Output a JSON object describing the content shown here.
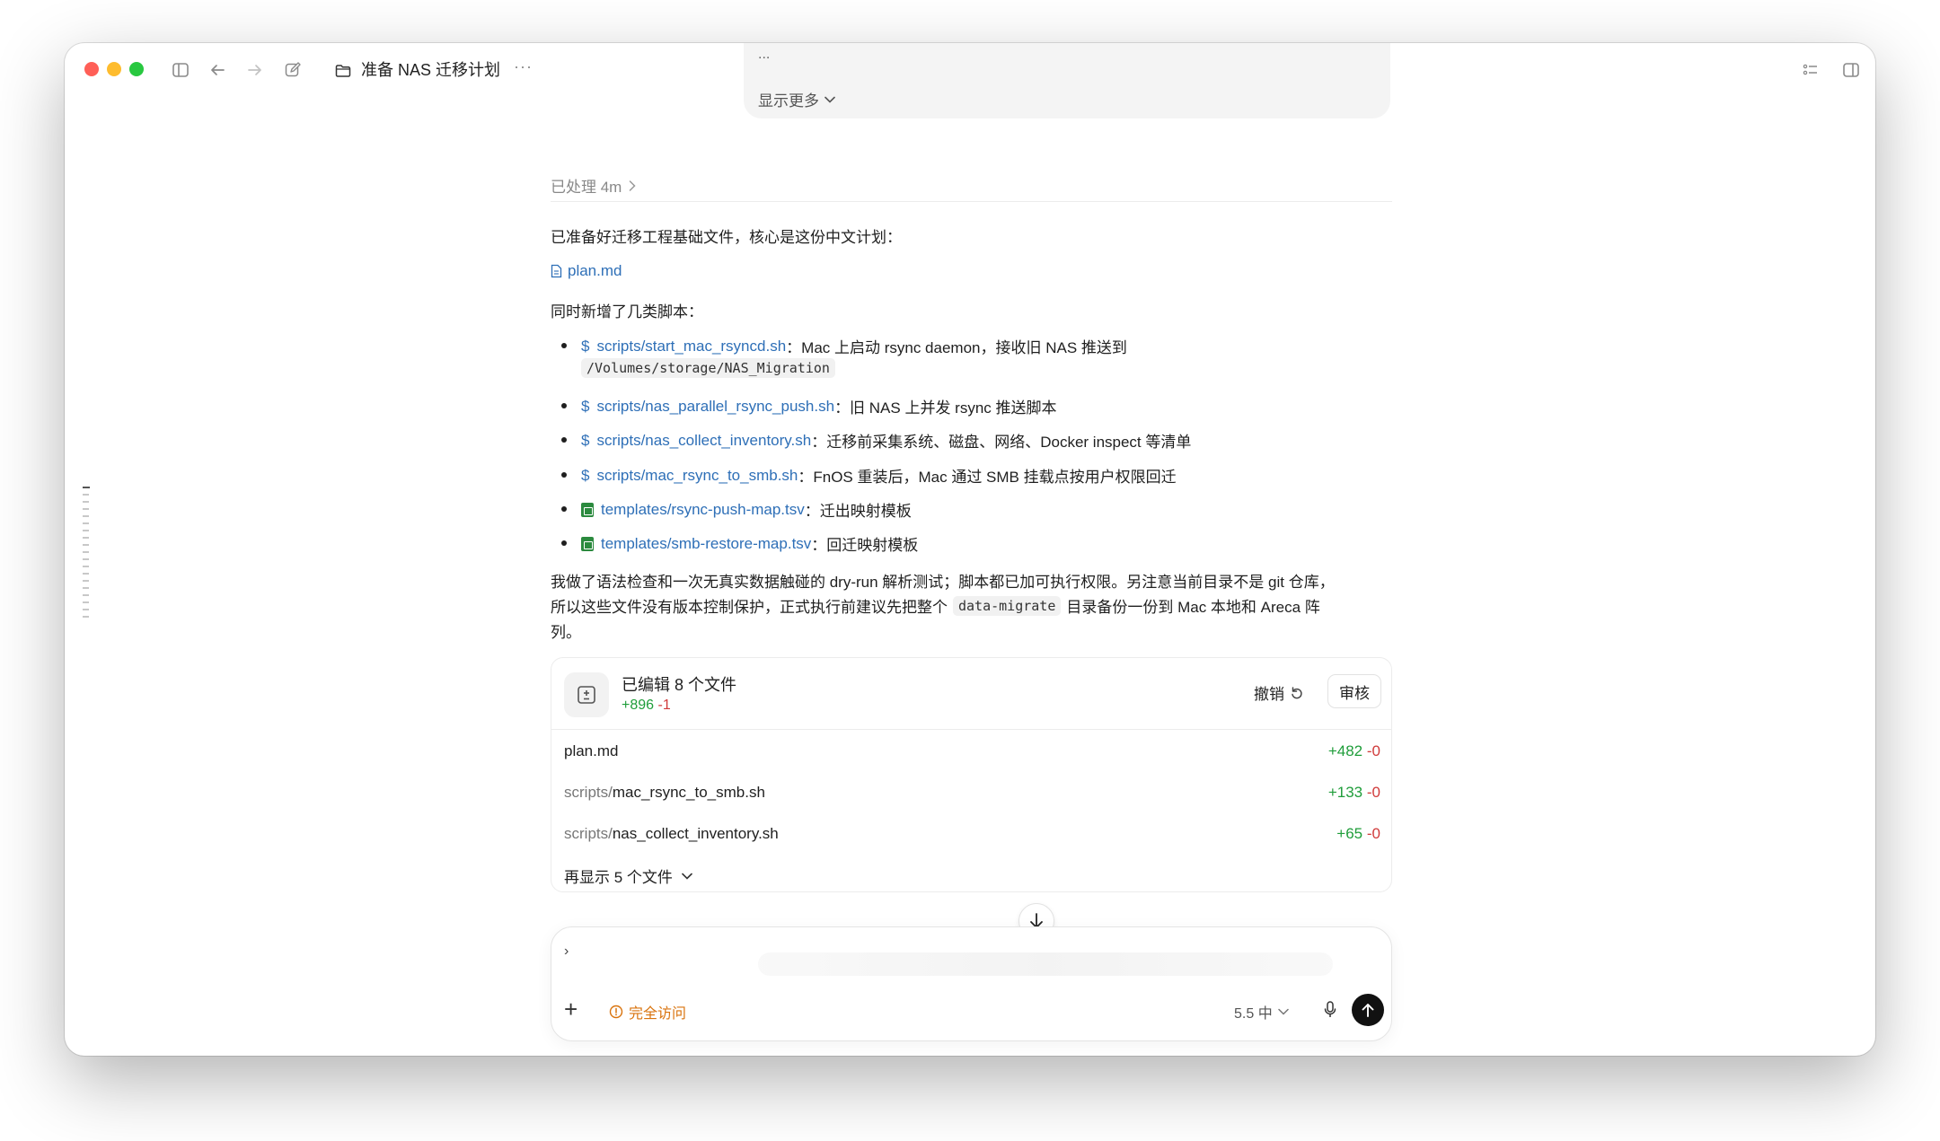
{
  "window": {
    "title": "准备 NAS 迁移计划",
    "more": "···"
  },
  "previous_message": {
    "ellipsis": "...",
    "show_more": "显示更多"
  },
  "processed": "已处理 4m",
  "intro": "已准备好迁移工程基础文件，核心是这份中文计划：",
  "plan_link": "plan.md",
  "scripts_intro": "同时新增了几类脚本：",
  "bullets": [
    {
      "link": "scripts/start_mac_rsyncd.sh",
      "desc": "：Mac 上启动 rsync daemon，接收旧 NAS 推送到",
      "code": "/Volumes/storage/NAS_Migration"
    },
    {
      "link": "scripts/nas_parallel_rsync_push.sh",
      "desc": "：旧 NAS 上并发 rsync 推送脚本"
    },
    {
      "link": "scripts/nas_collect_inventory.sh",
      "desc": "：迁移前采集系统、磁盘、网络、Docker inspect 等清单"
    },
    {
      "link": "scripts/mac_rsync_to_smb.sh",
      "desc": "：FnOS 重装后，Mac 通过 SMB 挂载点按用户权限回迁"
    },
    {
      "link": "templates/rsync-push-map.tsv",
      "desc": "：迁出映射模板"
    },
    {
      "link": "templates/smb-restore-map.tsv",
      "desc": "：回迁映射模板"
    }
  ],
  "note": {
    "line1": "我做了语法检查和一次无真实数据触碰的 dry-run 解析测试；脚本都已加可执行权限。另注意当前目录不是 git 仓库，",
    "line2_pre": "所以这些文件没有版本控制保护，正式执行前建议先把整个",
    "line2_code": "data-migrate",
    "line2_post": "目录备份一份到 Mac 本地和 Areca 阵",
    "line3": "列。"
  },
  "edits": {
    "title": "已编辑 8 个文件",
    "added": "+896",
    "removed": "-1",
    "undo": "撤销",
    "review": "审核",
    "files": [
      {
        "dir": "",
        "name": "plan.md",
        "added": "+482",
        "removed": "-0"
      },
      {
        "dir": "scripts/",
        "name": "mac_rsync_to_smb.sh",
        "added": "+133",
        "removed": "-0"
      },
      {
        "dir": "scripts/",
        "name": "nas_collect_inventory.sh",
        "added": "+65",
        "removed": "-0"
      }
    ],
    "show_more": "再显示 5 个文件"
  },
  "composer": {
    "caret": "›",
    "access": "完全访问",
    "model": "5.5 中"
  },
  "colors": {
    "link": "#2e6fb7",
    "added": "#1f9d3a",
    "removed": "#d03a3a",
    "access": "#d9730d",
    "close": "#ff5f57",
    "minimize": "#febc2e",
    "zoom": "#28c840"
  }
}
